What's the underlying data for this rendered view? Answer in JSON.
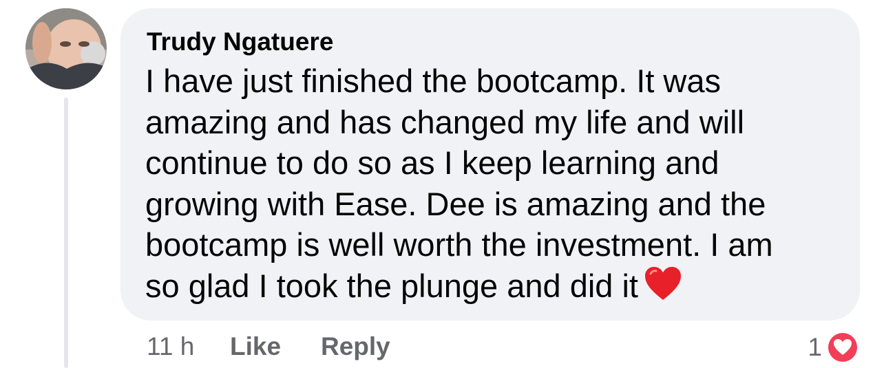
{
  "comment": {
    "author": "Trudy Ngatuere",
    "text_lines": [
      "I have just finished the bootcamp. It was",
      "amazing and has changed my life and will",
      "continue to do so as I keep learning and",
      "growing with Ease. Dee is amazing and the",
      "bootcamp is well worth the investment. I am",
      "so glad I took the plunge and did it"
    ],
    "emoji": "red-heart-icon",
    "timestamp": "11 h",
    "like_label": "Like",
    "reply_label": "Reply",
    "reaction_count": "1",
    "reaction_icon": "love-reaction-icon"
  },
  "colors": {
    "bubble": "#f0f2f5",
    "text": "#050505",
    "secondary_text": "#65676b",
    "love_reaction": "#f33e58",
    "thread_line": "#e4e6eb"
  }
}
